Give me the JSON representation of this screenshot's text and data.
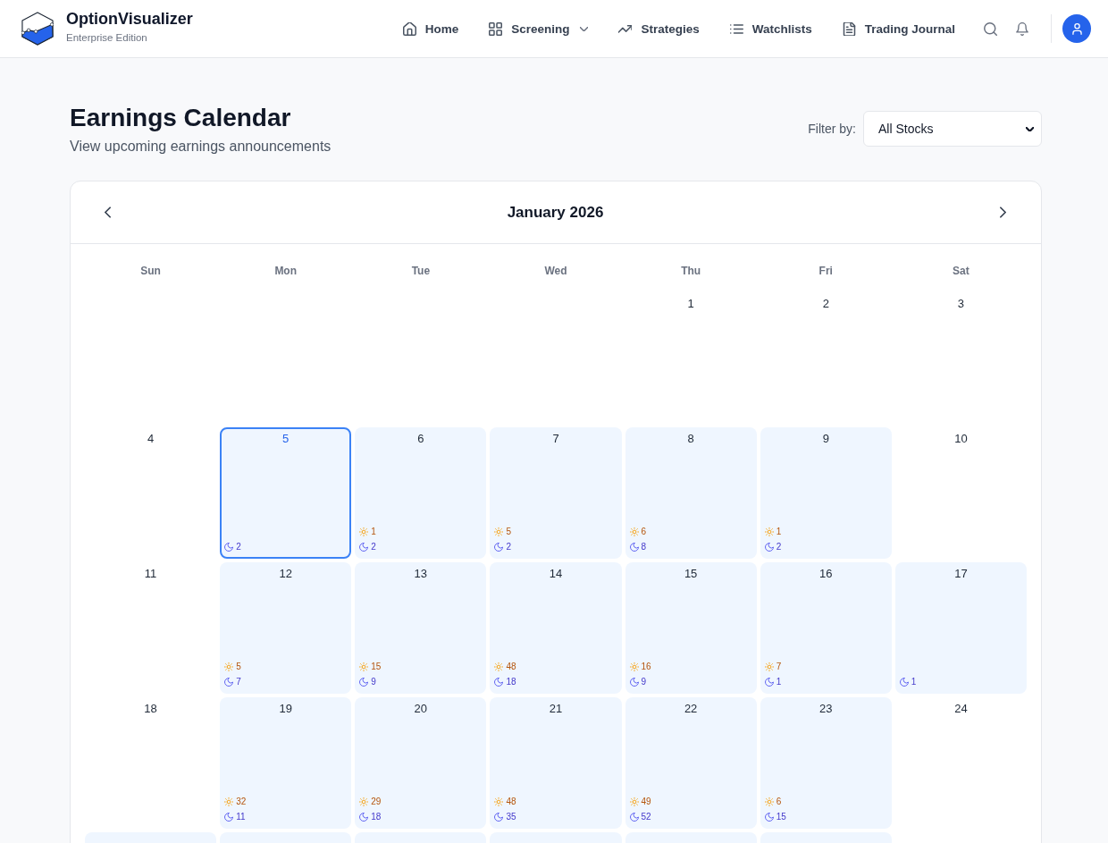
{
  "header": {
    "brand": {
      "name": "OptionVisualizer",
      "edition": "Enterprise Edition"
    },
    "nav": [
      {
        "label": "Home",
        "dropdown": false
      },
      {
        "label": "Screening",
        "dropdown": true
      },
      {
        "label": "Strategies",
        "dropdown": false
      },
      {
        "label": "Watchlists",
        "dropdown": false
      },
      {
        "label": "Trading Journal",
        "dropdown": false
      }
    ]
  },
  "page": {
    "title": "Earnings Calendar",
    "subtitle": "View upcoming earnings announcements",
    "filter": {
      "label": "Filter by:",
      "value": "All Stocks"
    }
  },
  "calendar": {
    "month": "January 2026",
    "weekdays": [
      "Sun",
      "Mon",
      "Tue",
      "Wed",
      "Thu",
      "Fri",
      "Sat"
    ],
    "weeks": [
      [
        {
          "kind": "blank"
        },
        {
          "kind": "blank"
        },
        {
          "kind": "blank"
        },
        {
          "kind": "blank"
        },
        {
          "kind": "day",
          "day": "1",
          "highlighted": false,
          "selected": false
        },
        {
          "kind": "day",
          "day": "2",
          "highlighted": false,
          "selected": false
        },
        {
          "kind": "day",
          "day": "3",
          "highlighted": false,
          "selected": false
        }
      ],
      [
        {
          "kind": "day",
          "day": "4",
          "highlighted": false,
          "selected": false
        },
        {
          "kind": "day",
          "day": "5",
          "highlighted": true,
          "selected": true,
          "moon_count": "2"
        },
        {
          "kind": "day",
          "day": "6",
          "highlighted": true,
          "selected": false,
          "sun_count": "1",
          "moon_count": "2"
        },
        {
          "kind": "day",
          "day": "7",
          "highlighted": true,
          "selected": false,
          "sun_count": "5",
          "moon_count": "2"
        },
        {
          "kind": "day",
          "day": "8",
          "highlighted": true,
          "selected": false,
          "sun_count": "6",
          "moon_count": "8"
        },
        {
          "kind": "day",
          "day": "9",
          "highlighted": true,
          "selected": false,
          "sun_count": "1",
          "moon_count": "2"
        },
        {
          "kind": "day",
          "day": "10",
          "highlighted": false,
          "selected": false
        }
      ],
      [
        {
          "kind": "day",
          "day": "11",
          "highlighted": false,
          "selected": false
        },
        {
          "kind": "day",
          "day": "12",
          "highlighted": true,
          "selected": false,
          "sun_count": "5",
          "moon_count": "7"
        },
        {
          "kind": "day",
          "day": "13",
          "highlighted": true,
          "selected": false,
          "sun_count": "15",
          "moon_count": "9"
        },
        {
          "kind": "day",
          "day": "14",
          "highlighted": true,
          "selected": false,
          "sun_count": "48",
          "moon_count": "18"
        },
        {
          "kind": "day",
          "day": "15",
          "highlighted": true,
          "selected": false,
          "sun_count": "16",
          "moon_count": "9"
        },
        {
          "kind": "day",
          "day": "16",
          "highlighted": true,
          "selected": false,
          "sun_count": "7",
          "moon_count": "1"
        },
        {
          "kind": "day",
          "day": "17",
          "highlighted": true,
          "selected": false,
          "moon_count": "1"
        }
      ],
      [
        {
          "kind": "day",
          "day": "18",
          "highlighted": false,
          "selected": false
        },
        {
          "kind": "day",
          "day": "19",
          "highlighted": true,
          "selected": false,
          "sun_count": "32",
          "moon_count": "11"
        },
        {
          "kind": "day",
          "day": "20",
          "highlighted": true,
          "selected": false,
          "sun_count": "29",
          "moon_count": "18"
        },
        {
          "kind": "day",
          "day": "21",
          "highlighted": true,
          "selected": false,
          "sun_count": "48",
          "moon_count": "35"
        },
        {
          "kind": "day",
          "day": "22",
          "highlighted": true,
          "selected": false,
          "sun_count": "49",
          "moon_count": "52"
        },
        {
          "kind": "day",
          "day": "23",
          "highlighted": true,
          "selected": false,
          "sun_count": "6",
          "moon_count": "15"
        },
        {
          "kind": "day",
          "day": "24",
          "highlighted": false,
          "selected": false
        }
      ],
      [
        {
          "kind": "day",
          "highlighted": true,
          "selected": false
        },
        {
          "kind": "day",
          "highlighted": true,
          "selected": false
        },
        {
          "kind": "day",
          "highlighted": true,
          "selected": false
        },
        {
          "kind": "day",
          "highlighted": true,
          "selected": false
        },
        {
          "kind": "day",
          "highlighted": true,
          "selected": false
        },
        {
          "kind": "day",
          "highlighted": true,
          "selected": false
        }
      ]
    ]
  }
}
